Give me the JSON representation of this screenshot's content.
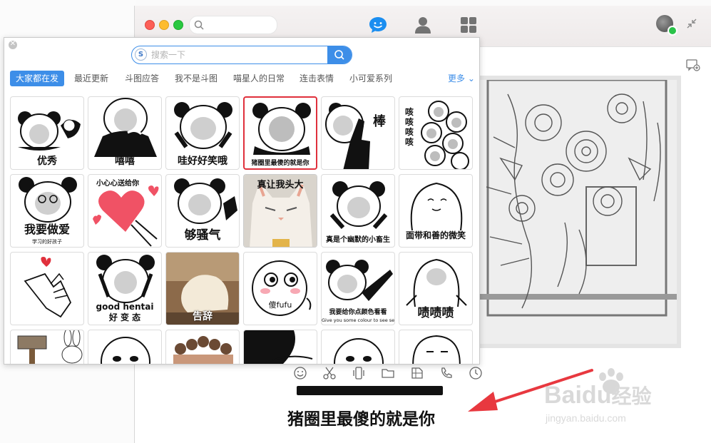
{
  "main_window": {
    "nav_icons": [
      "chat-bubble-icon",
      "contacts-icon",
      "apps-grid-icon"
    ],
    "accent_color": "#1b8ef0",
    "online_color": "#2bc34a"
  },
  "sticker_panel": {
    "search_placeholder": "搜索一下",
    "search_logo": "S",
    "tabs": [
      "大家都在发",
      "最近更新",
      "斗图应答",
      "我不是斗图",
      "喵星人的日常",
      "连击表情",
      "小可爱系列"
    ],
    "more_label": "更多",
    "stickers": [
      {
        "caption": "优秀",
        "selected": false
      },
      {
        "caption": "嘻嘻",
        "selected": false
      },
      {
        "caption": "哇好好笑哦",
        "selected": false
      },
      {
        "caption": "猪圈里最傻的就是你",
        "selected": true
      },
      {
        "caption": "棒",
        "selected": false
      },
      {
        "caption": "咳咳咳咳",
        "selected": false
      },
      {
        "caption": "我要做爱",
        "sub": "学习的好孩子",
        "selected": false
      },
      {
        "caption": "小心心送给你",
        "selected": false
      },
      {
        "caption": "够骚气",
        "selected": false
      },
      {
        "caption": "真让我头大",
        "selected": false
      },
      {
        "caption": "真是个幽默的小畜生",
        "selected": false
      },
      {
        "caption": "面带和善的微笑",
        "selected": false
      },
      {
        "caption": "",
        "selected": false
      },
      {
        "caption": "good hentai",
        "sub": "好 变 态",
        "selected": false
      },
      {
        "caption": "告辞",
        "selected": false
      },
      {
        "caption": "傻fufu",
        "selected": false
      },
      {
        "caption": "我要给你点颜色看看",
        "sub": "Give you some colour to see see",
        "selected": false
      },
      {
        "caption": "啧啧啧",
        "selected": false
      },
      {
        "caption": "",
        "selected": false
      },
      {
        "caption": "",
        "selected": false
      },
      {
        "caption": "",
        "selected": false
      },
      {
        "caption": "",
        "selected": false
      },
      {
        "caption": "",
        "selected": false
      },
      {
        "caption": "",
        "selected": false
      }
    ],
    "highlight_color": "#e0303c",
    "accent_color": "#3d8ee8"
  },
  "chat_toolbar": {
    "icons": [
      "emoji-icon",
      "scissors-icon",
      "phone-shake-icon",
      "folder-icon",
      "screenshot-icon",
      "call-icon",
      "history-clock-icon"
    ]
  },
  "sent_message": {
    "caption": "猪圈里最傻的就是你"
  },
  "annotation": {
    "arrow_color": "#e8383f"
  },
  "watermark": {
    "brand": "Bai",
    "brand_tail": "du",
    "cn": "经验",
    "url": "jingyan.baidu.com"
  }
}
